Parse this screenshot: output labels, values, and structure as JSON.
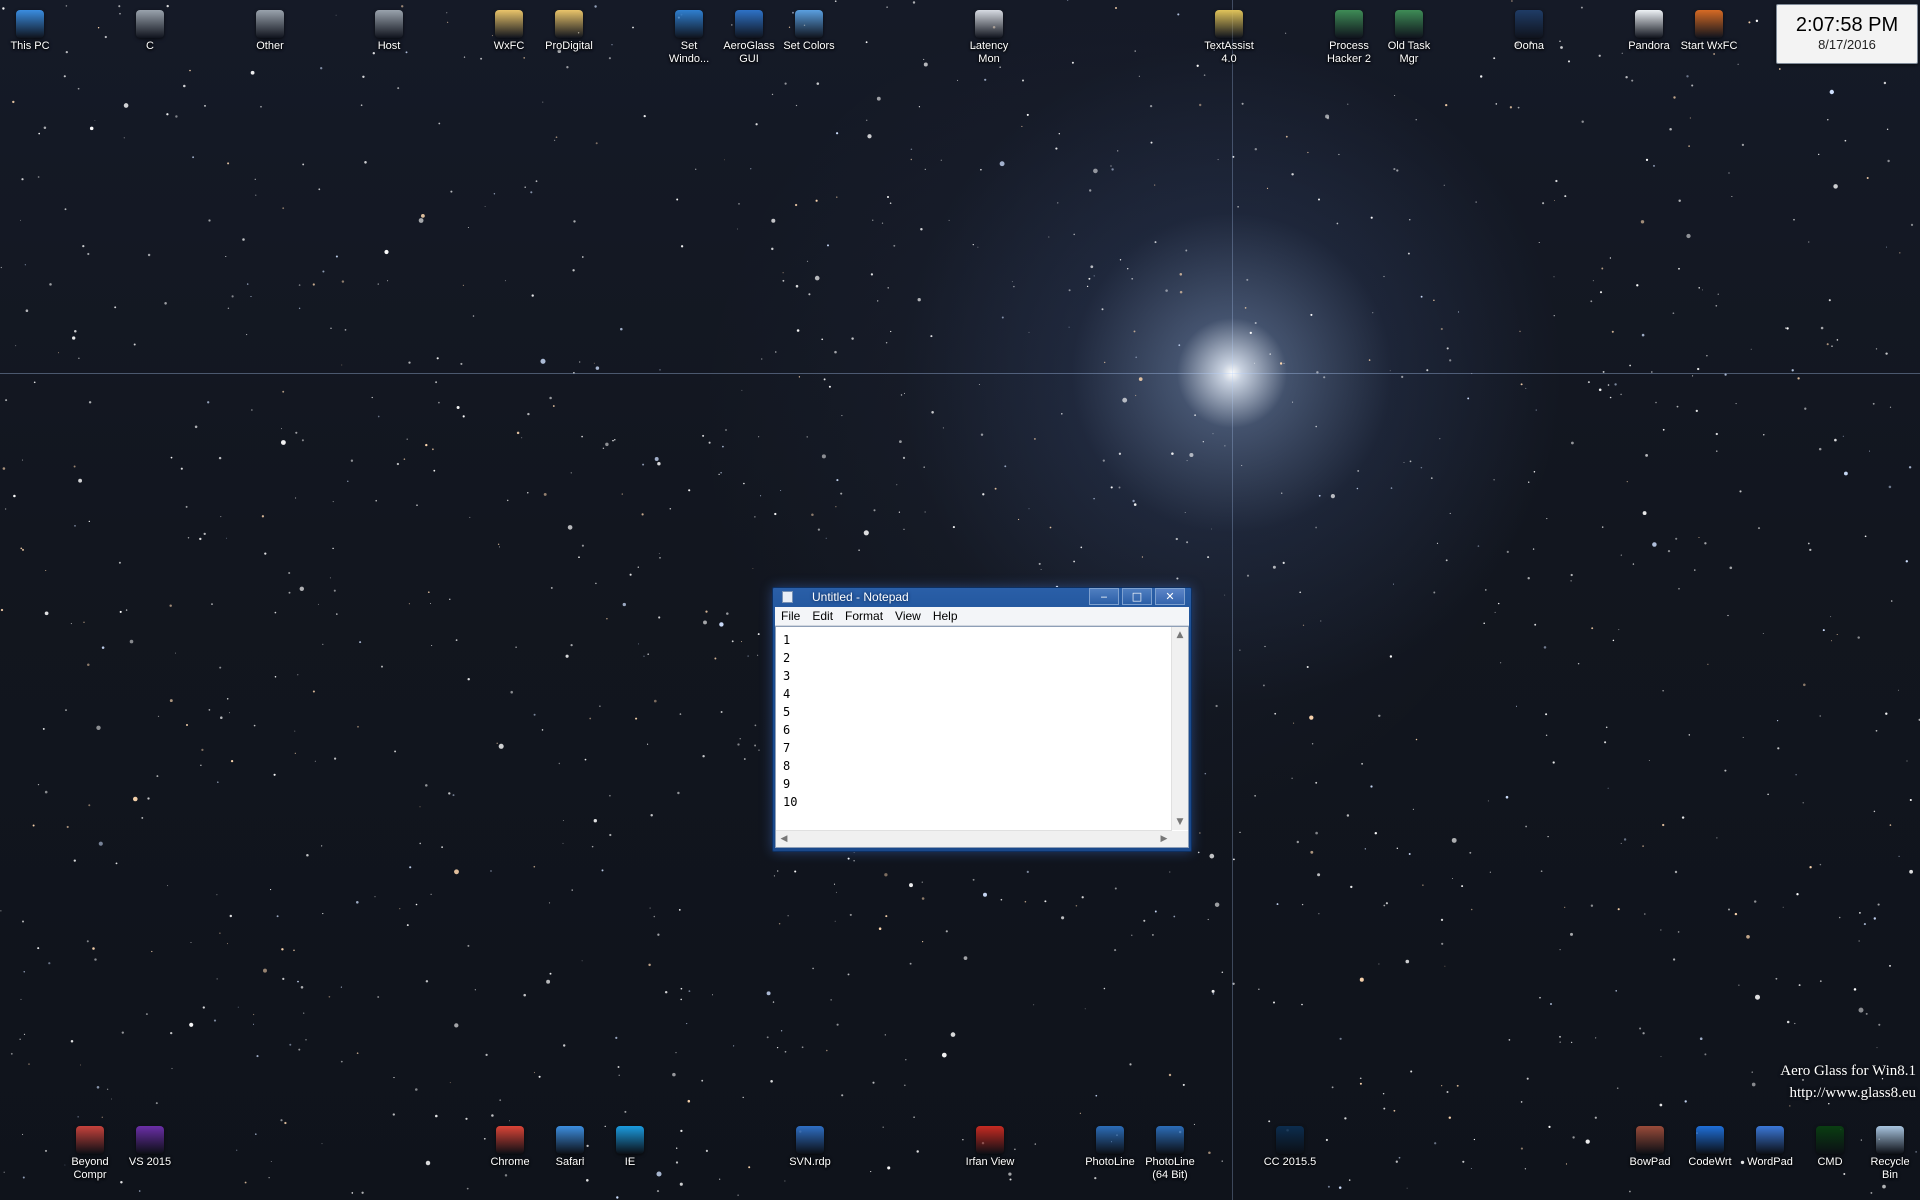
{
  "clock": {
    "time": "2:07:58 PM",
    "date": "8/17/2016"
  },
  "watermark": {
    "line1": "Aero Glass for Win8.1",
    "line2": "http://www.glass8.eu"
  },
  "desktop_top_icons": [
    {
      "label": "This PC",
      "icon": "monitor-icon",
      "color": "#3a8de0"
    },
    {
      "label": "C",
      "icon": "drive-icon",
      "color": "#9aa3ad"
    },
    {
      "label": "Other",
      "icon": "drive-icon",
      "color": "#9aa3ad"
    },
    {
      "label": "Host",
      "icon": "drive-icon",
      "color": "#9aa3ad"
    },
    {
      "label": "WxFC",
      "icon": "folder-icon",
      "color": "#e9c46a"
    },
    {
      "label": "ProDigital",
      "icon": "folder-icon",
      "color": "#e9c46a"
    },
    {
      "label": "Set Windo...",
      "icon": "settings-app-icon",
      "color": "#2f7fd0"
    },
    {
      "label": "AeroGlass GUI",
      "icon": "window-app-icon",
      "color": "#2e72c7"
    },
    {
      "label": "Set Colors",
      "icon": "palette-app-icon",
      "color": "#5aa0e0"
    },
    {
      "label": "Latency Mon",
      "icon": "monitor-app-icon",
      "color": "#d7dbe2"
    },
    {
      "label": "TextAssist 4.0",
      "icon": "textassist-icon",
      "color": "#e0c35a"
    },
    {
      "label": "Process Hacker 2",
      "icon": "process-hacker-icon",
      "color": "#3e8c56"
    },
    {
      "label": "Old Task Mgr",
      "icon": "task-manager-icon",
      "color": "#3e8c56"
    },
    {
      "label": "Ooma",
      "icon": "ooma-icon",
      "color": "#1f3c66"
    },
    {
      "label": "Pandora",
      "icon": "pandora-icon",
      "color": "#eef2f6"
    },
    {
      "label": "Start WxFC",
      "icon": "firewall-icon",
      "color": "#d66a24"
    }
  ],
  "desktop_bottom_icons": [
    {
      "label": "Beyond Compr",
      "icon": "beyond-compare-icon",
      "color": "#c7423c"
    },
    {
      "label": "VS 2015",
      "icon": "visual-studio-icon",
      "color": "#6b2fa8"
    },
    {
      "label": "Chrome",
      "icon": "chrome-icon",
      "color": "#db4437"
    },
    {
      "label": "Safari",
      "icon": "safari-icon",
      "color": "#3d8fe0"
    },
    {
      "label": "IE",
      "icon": "ie-icon",
      "color": "#1b9ce0"
    },
    {
      "label": "SVN.rdp",
      "icon": "rdp-icon",
      "color": "#2f6fc4"
    },
    {
      "label": "Irfan View",
      "icon": "irfanview-icon",
      "color": "#c72b22"
    },
    {
      "label": "PhotoLine",
      "icon": "photoline-icon",
      "color": "#2c6db8"
    },
    {
      "label": "PhotoLine (64 Bit)",
      "icon": "photoline-icon",
      "color": "#2c6db8"
    },
    {
      "label": "CC 2015.5",
      "icon": "photoshop-icon",
      "color": "#0c2d4e"
    },
    {
      "label": "BowPad",
      "icon": "bowpad-icon",
      "color": "#9a4b3a"
    },
    {
      "label": "CodeWrt",
      "icon": "codewrt-icon",
      "color": "#1f6fd8"
    },
    {
      "label": "WordPad",
      "icon": "wordpad-icon",
      "color": "#3b78d8"
    },
    {
      "label": "CMD",
      "icon": "cmd-icon",
      "color": "#0a3e12"
    },
    {
      "label": "Recycle Bin",
      "icon": "recycle-bin-icon",
      "color": "#a9c5e0"
    }
  ],
  "notepad": {
    "title": "Untitled - Notepad",
    "menu": [
      "File",
      "Edit",
      "Format",
      "View",
      "Help"
    ],
    "lines": [
      "1",
      "2",
      "3",
      "4",
      "5",
      "6",
      "7",
      "8",
      "9",
      "10"
    ],
    "minimize_glyph": "‒",
    "maximize_glyph": "□",
    "close_glyph": "✕"
  }
}
